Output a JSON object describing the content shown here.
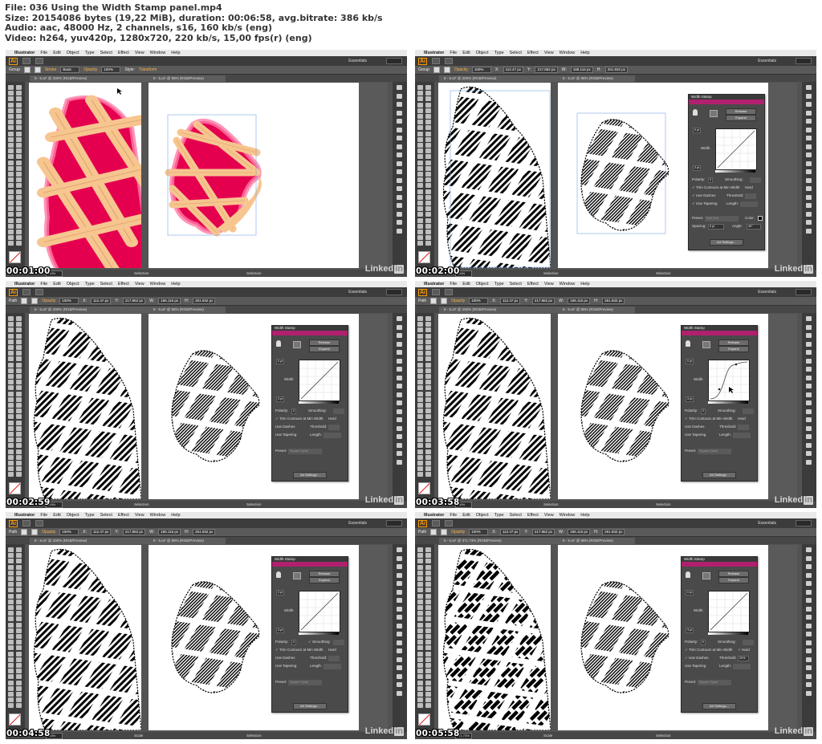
{
  "header": {
    "line1": "File: 036 Using the Width Stamp panel.mp4",
    "line2": "Size: 20154086 bytes (19,22 MiB), duration: 00:06:58, avg.bitrate: 386 kb/s",
    "line3": "Audio: aac, 48000 Hz, 2 channels, s16, 160 kb/s (eng)",
    "line4": "Video: h264, yuv420p, 1280x720, 220 kb/s, 15,00 fps(r) (eng)"
  },
  "app": {
    "apple": "",
    "name": "Illustrator",
    "menus": [
      "File",
      "Edit",
      "Object",
      "Type",
      "Select",
      "Effect",
      "View",
      "Window",
      "Help"
    ],
    "logo": "Ai",
    "workspace": "Essentials"
  },
  "watermark": {
    "text": "Linked",
    "in": "in"
  },
  "frames": [
    {
      "timestamp": "00:01:00",
      "ctrl_kind": "Group",
      "ctrl_labels": [
        "Stroke",
        "Basic",
        "Opacity",
        "100%",
        "Style:",
        "Transform"
      ],
      "tab_left": "8 - 5.ai* @ 200% (RGB/Preview)",
      "tab_right": "8 - 5.ai* @ 98% (RGB/Preview)",
      "status_zoom": "200%",
      "status_tool": "Selection",
      "status_tool2": "Selection",
      "art": "color",
      "panel": null
    },
    {
      "timestamp": "00:02:00",
      "ctrl_kind": "Group",
      "ctrl_labels": [
        "Opacity",
        "100%",
        "X:",
        "112.47 px",
        "Y:",
        "217.862 px",
        "W:",
        "186.116 px",
        "H:",
        "251.932 px"
      ],
      "tab_left": "8 - 5.ai* @ 200% (RGB/Preview)",
      "tab_right": "8 - 5.ai* @ 98% (RGB/Preview)",
      "status_zoom": "200%",
      "status_tool": "Selection",
      "status_tool2": "Selection",
      "art": "stamp",
      "panel": {
        "title": "Width Stamp",
        "release": "Release",
        "expand": "Expand",
        "top_value": "0 pt",
        "bottom_value": "3 pt",
        "width_label": "Width",
        "polarity": "Polarity:",
        "polarity_value": "0",
        "smoothing": "Smoothing:",
        "trim": "✓ Trim Contours at Min Width",
        "hard": "Hard",
        "use_dashes": "✓ Use Dashes",
        "threshold": "Threshold:",
        "use_tapering": "✓ Use Tapering",
        "length": "Length:",
        "preset": "Preset:",
        "preset_value": "Half Grid",
        "color": "Color:",
        "spacing": "Spacing:",
        "spacing_value": "6 pt",
        "angle": "Angle:",
        "angle_value": "45°",
        "settings": "Art Settings...",
        "curve": "linear",
        "extra": true
      }
    },
    {
      "timestamp": "00:02:59",
      "ctrl_kind": "Path",
      "ctrl_labels": [
        "Opacity",
        "100%",
        "X:",
        "112.47 px",
        "Y:",
        "217.862 px",
        "W:",
        "186.116 px",
        "H:",
        "251.932 px"
      ],
      "tab_left": "8 - 5.ai* @ 200% (RGB/Preview)",
      "tab_right": "8 - 5.ai* @ 98% (RGB/Preview)",
      "status_zoom": "200%",
      "status_tool": "Selection",
      "status_tool2": "Selection",
      "art": "stamp",
      "panel": {
        "title": "Width Stamp",
        "release": "Release",
        "expand": "Expand",
        "top_value": "0 pt",
        "bottom_value": "3 pt",
        "width_label": "Width",
        "polarity": "Polarity:",
        "polarity_value": "0",
        "smoothing": "Smoothing:",
        "trim": "✓ Trim Contours at Min Width",
        "hard": "Hard",
        "use_dashes": "Use Dashes",
        "threshold": "Threshold:",
        "use_tapering": "Use Tapering",
        "length": "Length:",
        "preset": "Preset:",
        "preset_value": "Square Spiral",
        "settings": "Art Settings...",
        "curve": "linear",
        "extra": false
      }
    },
    {
      "timestamp": "00:03:58",
      "ctrl_kind": "Path",
      "ctrl_labels": [
        "Opacity",
        "100%",
        "X:",
        "112.47 px",
        "Y:",
        "217.862 px",
        "W:",
        "186.116 px",
        "H:",
        "251.932 px"
      ],
      "tab_left": "8 - 5.ai* @ 200% (RGB/Preview)",
      "tab_right": "8 - 5.ai* @ 98% (RGB/Preview)",
      "status_zoom": "200%",
      "status_tool": "Selection",
      "status_tool2": "Selection",
      "art": "stamp",
      "panel": {
        "title": "Width Stamp",
        "release": "Release",
        "expand": "Expand",
        "top_value": "0 pt",
        "bottom_value": "3 pt",
        "width_label": "Width",
        "polarity": "Polarity:",
        "polarity_value": "0",
        "smoothing": "Smoothing:",
        "trim": "✓ Trim Contours at Min Width",
        "hard": "Hard",
        "use_dashes": "Use Dashes",
        "threshold": "Threshold:",
        "use_tapering": "Use Tapering",
        "length": "Length:",
        "preset": "Preset:",
        "preset_value": "Square Spiral",
        "settings": "Art Settings...",
        "curve": "s-curve",
        "extra": false
      }
    },
    {
      "timestamp": "00:04:58",
      "ctrl_kind": "Path",
      "ctrl_labels": [
        "Opacity",
        "100%",
        "X:",
        "112.47 px",
        "Y:",
        "217.862 px",
        "W:",
        "186.116 px",
        "H:",
        "251.932 px"
      ],
      "tab_left": "8 - 5.ai* @ 200% (RGB/Preview)",
      "tab_right": "8 - 5.ai* @ 98% (RGB/Preview)",
      "status_zoom": "200%",
      "status_tool": "Scale",
      "status_tool2": "Selection",
      "art": "stamp",
      "panel": {
        "title": "Width Stamp",
        "release": "Release",
        "expand": "Expand",
        "top_value": "0 pt",
        "bottom_value": "3 pt",
        "width_label": "Width",
        "polarity": "Polarity:",
        "polarity_value": "0",
        "smoothing": "✓ Smoothing:",
        "trim": "✓ Trim Contours at Min Width",
        "hard": "Hard",
        "use_dashes": "Use Dashes",
        "threshold": "Threshold:",
        "use_tapering": "Use Tapering",
        "length": "Length:",
        "preset": "Preset:",
        "preset_value": "Square Spiral",
        "settings": "Art Settings...",
        "curve": "linear",
        "extra": false
      }
    },
    {
      "timestamp": "00:05:58",
      "ctrl_kind": "Path",
      "ctrl_labels": [
        "Opacity",
        "100%",
        "X:",
        "112.47 px",
        "Y:",
        "217.862 px",
        "W:",
        "186.116 px",
        "H:",
        "251.932 px"
      ],
      "tab_left": "8 - 5.ai* @ 371.73% (RGB/Preview)",
      "tab_right": "8 - 5.ai* @ 98% (RGB/Preview)",
      "status_zoom": "371.73%",
      "status_tool": "Scale",
      "status_tool2": "Selection",
      "art": "dashes",
      "panel": {
        "title": "Width Stamp",
        "release": "Release",
        "expand": "Expand",
        "top_value": "0 pt",
        "bottom_value": "3 pt",
        "width_label": "Width",
        "polarity": "Polarity:",
        "polarity_value": "0",
        "smoothing": "Smoothing:",
        "trim": "✓ Trim Contours at Min Width",
        "hard": "✓ Hard",
        "use_dashes": "✓ Use Dashes",
        "threshold": "Threshold:",
        "threshold_value": "20%",
        "use_tapering": "Use Tapering",
        "length": "Length:",
        "preset": "Preset:",
        "preset_value": "Square Spiral",
        "settings": "Art Settings...",
        "curve": "linear",
        "extra": false
      }
    }
  ]
}
